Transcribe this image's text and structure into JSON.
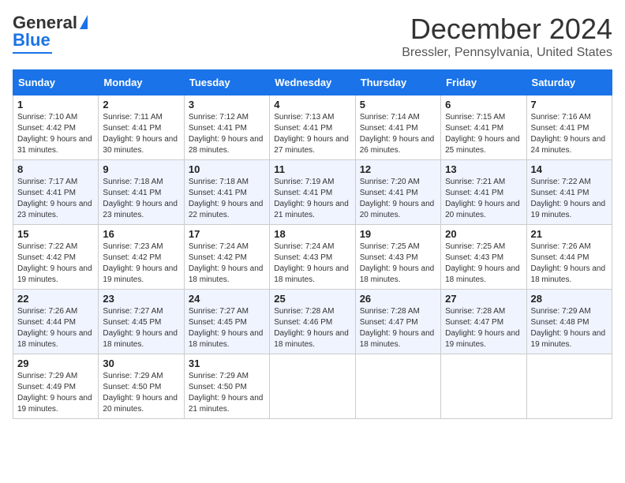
{
  "header": {
    "logo_line1": "General",
    "logo_line2": "Blue",
    "month": "December 2024",
    "location": "Bressler, Pennsylvania, United States"
  },
  "weekdays": [
    "Sunday",
    "Monday",
    "Tuesday",
    "Wednesday",
    "Thursday",
    "Friday",
    "Saturday"
  ],
  "weeks": [
    [
      {
        "day": "1",
        "sunrise": "Sunrise: 7:10 AM",
        "sunset": "Sunset: 4:42 PM",
        "daylight": "Daylight: 9 hours and 31 minutes."
      },
      {
        "day": "2",
        "sunrise": "Sunrise: 7:11 AM",
        "sunset": "Sunset: 4:41 PM",
        "daylight": "Daylight: 9 hours and 30 minutes."
      },
      {
        "day": "3",
        "sunrise": "Sunrise: 7:12 AM",
        "sunset": "Sunset: 4:41 PM",
        "daylight": "Daylight: 9 hours and 28 minutes."
      },
      {
        "day": "4",
        "sunrise": "Sunrise: 7:13 AM",
        "sunset": "Sunset: 4:41 PM",
        "daylight": "Daylight: 9 hours and 27 minutes."
      },
      {
        "day": "5",
        "sunrise": "Sunrise: 7:14 AM",
        "sunset": "Sunset: 4:41 PM",
        "daylight": "Daylight: 9 hours and 26 minutes."
      },
      {
        "day": "6",
        "sunrise": "Sunrise: 7:15 AM",
        "sunset": "Sunset: 4:41 PM",
        "daylight": "Daylight: 9 hours and 25 minutes."
      },
      {
        "day": "7",
        "sunrise": "Sunrise: 7:16 AM",
        "sunset": "Sunset: 4:41 PM",
        "daylight": "Daylight: 9 hours and 24 minutes."
      }
    ],
    [
      {
        "day": "8",
        "sunrise": "Sunrise: 7:17 AM",
        "sunset": "Sunset: 4:41 PM",
        "daylight": "Daylight: 9 hours and 23 minutes."
      },
      {
        "day": "9",
        "sunrise": "Sunrise: 7:18 AM",
        "sunset": "Sunset: 4:41 PM",
        "daylight": "Daylight: 9 hours and 23 minutes."
      },
      {
        "day": "10",
        "sunrise": "Sunrise: 7:18 AM",
        "sunset": "Sunset: 4:41 PM",
        "daylight": "Daylight: 9 hours and 22 minutes."
      },
      {
        "day": "11",
        "sunrise": "Sunrise: 7:19 AM",
        "sunset": "Sunset: 4:41 PM",
        "daylight": "Daylight: 9 hours and 21 minutes."
      },
      {
        "day": "12",
        "sunrise": "Sunrise: 7:20 AM",
        "sunset": "Sunset: 4:41 PM",
        "daylight": "Daylight: 9 hours and 20 minutes."
      },
      {
        "day": "13",
        "sunrise": "Sunrise: 7:21 AM",
        "sunset": "Sunset: 4:41 PM",
        "daylight": "Daylight: 9 hours and 20 minutes."
      },
      {
        "day": "14",
        "sunrise": "Sunrise: 7:22 AM",
        "sunset": "Sunset: 4:41 PM",
        "daylight": "Daylight: 9 hours and 19 minutes."
      }
    ],
    [
      {
        "day": "15",
        "sunrise": "Sunrise: 7:22 AM",
        "sunset": "Sunset: 4:42 PM",
        "daylight": "Daylight: 9 hours and 19 minutes."
      },
      {
        "day": "16",
        "sunrise": "Sunrise: 7:23 AM",
        "sunset": "Sunset: 4:42 PM",
        "daylight": "Daylight: 9 hours and 19 minutes."
      },
      {
        "day": "17",
        "sunrise": "Sunrise: 7:24 AM",
        "sunset": "Sunset: 4:42 PM",
        "daylight": "Daylight: 9 hours and 18 minutes."
      },
      {
        "day": "18",
        "sunrise": "Sunrise: 7:24 AM",
        "sunset": "Sunset: 4:43 PM",
        "daylight": "Daylight: 9 hours and 18 minutes."
      },
      {
        "day": "19",
        "sunrise": "Sunrise: 7:25 AM",
        "sunset": "Sunset: 4:43 PM",
        "daylight": "Daylight: 9 hours and 18 minutes."
      },
      {
        "day": "20",
        "sunrise": "Sunrise: 7:25 AM",
        "sunset": "Sunset: 4:43 PM",
        "daylight": "Daylight: 9 hours and 18 minutes."
      },
      {
        "day": "21",
        "sunrise": "Sunrise: 7:26 AM",
        "sunset": "Sunset: 4:44 PM",
        "daylight": "Daylight: 9 hours and 18 minutes."
      }
    ],
    [
      {
        "day": "22",
        "sunrise": "Sunrise: 7:26 AM",
        "sunset": "Sunset: 4:44 PM",
        "daylight": "Daylight: 9 hours and 18 minutes."
      },
      {
        "day": "23",
        "sunrise": "Sunrise: 7:27 AM",
        "sunset": "Sunset: 4:45 PM",
        "daylight": "Daylight: 9 hours and 18 minutes."
      },
      {
        "day": "24",
        "sunrise": "Sunrise: 7:27 AM",
        "sunset": "Sunset: 4:45 PM",
        "daylight": "Daylight: 9 hours and 18 minutes."
      },
      {
        "day": "25",
        "sunrise": "Sunrise: 7:28 AM",
        "sunset": "Sunset: 4:46 PM",
        "daylight": "Daylight: 9 hours and 18 minutes."
      },
      {
        "day": "26",
        "sunrise": "Sunrise: 7:28 AM",
        "sunset": "Sunset: 4:47 PM",
        "daylight": "Daylight: 9 hours and 18 minutes."
      },
      {
        "day": "27",
        "sunrise": "Sunrise: 7:28 AM",
        "sunset": "Sunset: 4:47 PM",
        "daylight": "Daylight: 9 hours and 19 minutes."
      },
      {
        "day": "28",
        "sunrise": "Sunrise: 7:29 AM",
        "sunset": "Sunset: 4:48 PM",
        "daylight": "Daylight: 9 hours and 19 minutes."
      }
    ],
    [
      {
        "day": "29",
        "sunrise": "Sunrise: 7:29 AM",
        "sunset": "Sunset: 4:49 PM",
        "daylight": "Daylight: 9 hours and 19 minutes."
      },
      {
        "day": "30",
        "sunrise": "Sunrise: 7:29 AM",
        "sunset": "Sunset: 4:50 PM",
        "daylight": "Daylight: 9 hours and 20 minutes."
      },
      {
        "day": "31",
        "sunrise": "Sunrise: 7:29 AM",
        "sunset": "Sunset: 4:50 PM",
        "daylight": "Daylight: 9 hours and 21 minutes."
      },
      null,
      null,
      null,
      null
    ]
  ]
}
